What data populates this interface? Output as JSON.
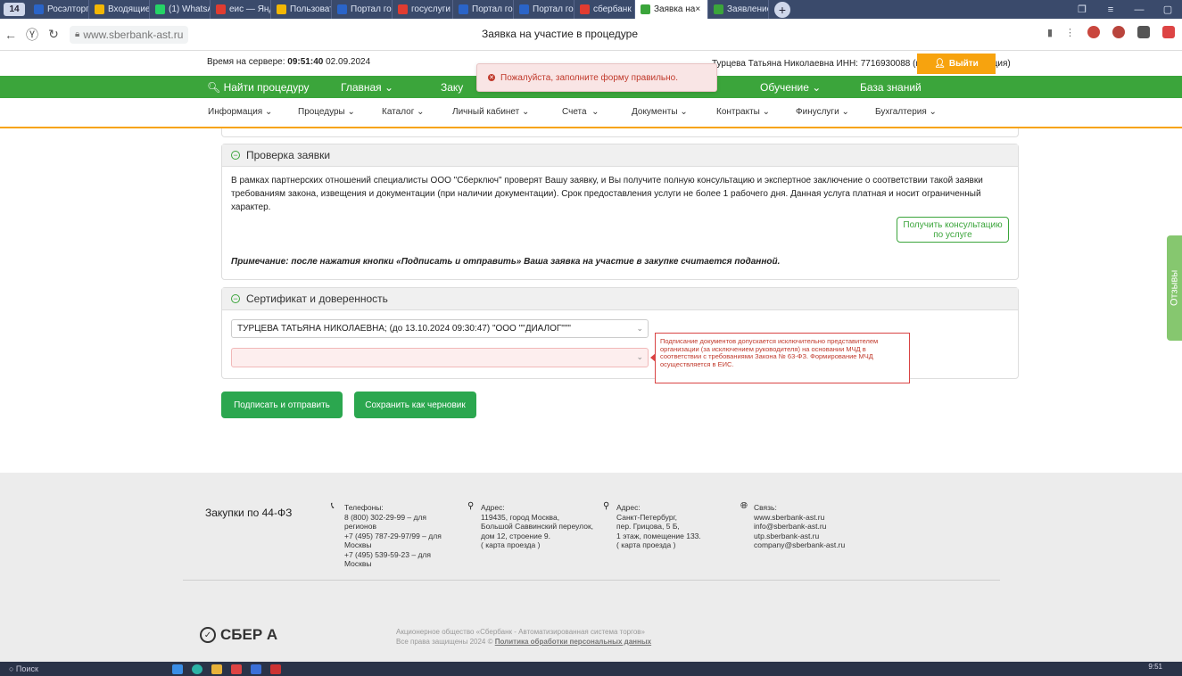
{
  "browser": {
    "tab_count": "14",
    "tabs": [
      {
        "label": "Росэлторг.р",
        "color": "#2a64c8"
      },
      {
        "label": "Входящие –",
        "color": "#f2b705"
      },
      {
        "label": "(1) WhatsAp",
        "color": "#25d366"
      },
      {
        "label": "еис — Яндек",
        "color": "#e03c31"
      },
      {
        "label": "Пользовате",
        "color": "#f2b705"
      },
      {
        "label": "Портал госу",
        "color": "#2a64c8"
      },
      {
        "label": "госуслуги –",
        "color": "#e03c31"
      },
      {
        "label": "Портал госу",
        "color": "#2a64c8"
      },
      {
        "label": "Портал госу",
        "color": "#2a64c8"
      },
      {
        "label": "сбербанк ас",
        "color": "#e03c31"
      },
      {
        "label": "Заявка на",
        "color": "#3ba53b",
        "active": true
      },
      {
        "label": "Заявление",
        "color": "#3ba53b"
      }
    ],
    "url": "www.sberbank-ast.ru",
    "page_title": "Заявка на участие в процедуре"
  },
  "topbar": {
    "server_time_label": "Время на сервере:",
    "server_time": "09:51:40",
    "server_date": "02.09.2024",
    "user_info": "Турцева Татьяна Николаевна ИНН: 7716930088 (головная организация)",
    "logout_label": "Выйти"
  },
  "toast": {
    "message": "Пожалуйста, заполните форму правильно."
  },
  "green_nav": {
    "search_label": "Найти процедуру",
    "main_label": "Главная",
    "purchases_label": "Заку",
    "training_label": "Обучение",
    "knowledge_label": "База знаний"
  },
  "sub_nav": {
    "items": [
      "Информация",
      "Процедуры",
      "Каталог",
      "Личный кабинет",
      "Счета",
      "Документы",
      "Контракты",
      "Финуслуги",
      "Бухгалтерия"
    ]
  },
  "check_panel": {
    "title": "Проверка заявки",
    "text": "В рамках партнерских отношений специалисты ООО \"Сберключ\" проверят Вашу заявку, и Вы получите полную консультацию и экспертное заключение о соответствии такой заявки требованиям закона, извещения и документации (при наличии документации). Срок предоставления услуги не более 1 рабочего дня. Данная услуга платная и носит ограниченный характер.",
    "consult_button": "Получить консультацию по услуге",
    "note": "Примечание: после нажатия кнопки «Подписать и отправить» Ваша заявка на участие в закупке считается поданной."
  },
  "cert_panel": {
    "title": "Сертификат и доверенность",
    "certificate_value": "ТУРЦЕВА ТАТЬЯНА НИКОЛАЕВНА; (до 13.10.2024 09:30:47) \"ООО \"\"ДИАЛОГ\"\"\"",
    "poa_value": "",
    "tooltip": "Подписание документов допускается исключительно представителем организации (за исключением руководителя) на основании МЧД в соответствии с требованиями Закона № 63-ФЗ. Формирование МЧД осуществляется в ЕИС."
  },
  "actions": {
    "sign_label": "Подписать и отправить",
    "draft_label": "Сохранить как черновик"
  },
  "feedback_label": "Отзывы",
  "footer": {
    "title": "Закупки по 44-ФЗ",
    "phones_title": "Телефоны:",
    "phones": [
      "8 (800) 302-29-99 – для регионов",
      "+7 (495) 787-29-97/99 – для Москвы",
      "+7 (495) 539-59-23 – для Москвы"
    ],
    "address1_title": "Адрес:",
    "address1": [
      "119435, город Москва,",
      "Большой Саввинский переулок,",
      "дом 12, строение 9.",
      "( карта проезда )"
    ],
    "address2_title": "Адрес:",
    "address2": [
      "Санкт-Петербург,",
      "пер. Грицова, 5 Б,",
      "1 этаж, помещение 133.",
      "( карта проезда )"
    ],
    "contact_title": "Связь:",
    "contacts": [
      "www.sberbank-ast.ru",
      "info@sberbank-ast.ru",
      "utp.sberbank-ast.ru",
      "company@sberbank-ast.ru"
    ],
    "logo": "СБЕР А",
    "copyright_line1": "Акционерное общество «Сбербанк - Автоматизированная система торгов»",
    "copyright_line2": "Все права защищены 2024 ©",
    "privacy_link": "Политика обработки персональных данных"
  },
  "taskbar": {
    "clock": "9:51"
  },
  "colors": {
    "brand_green": "#3ba53b",
    "accent_orange": "#f7a30e",
    "error_red": "#c0392b",
    "button_green": "#2ba74f"
  }
}
